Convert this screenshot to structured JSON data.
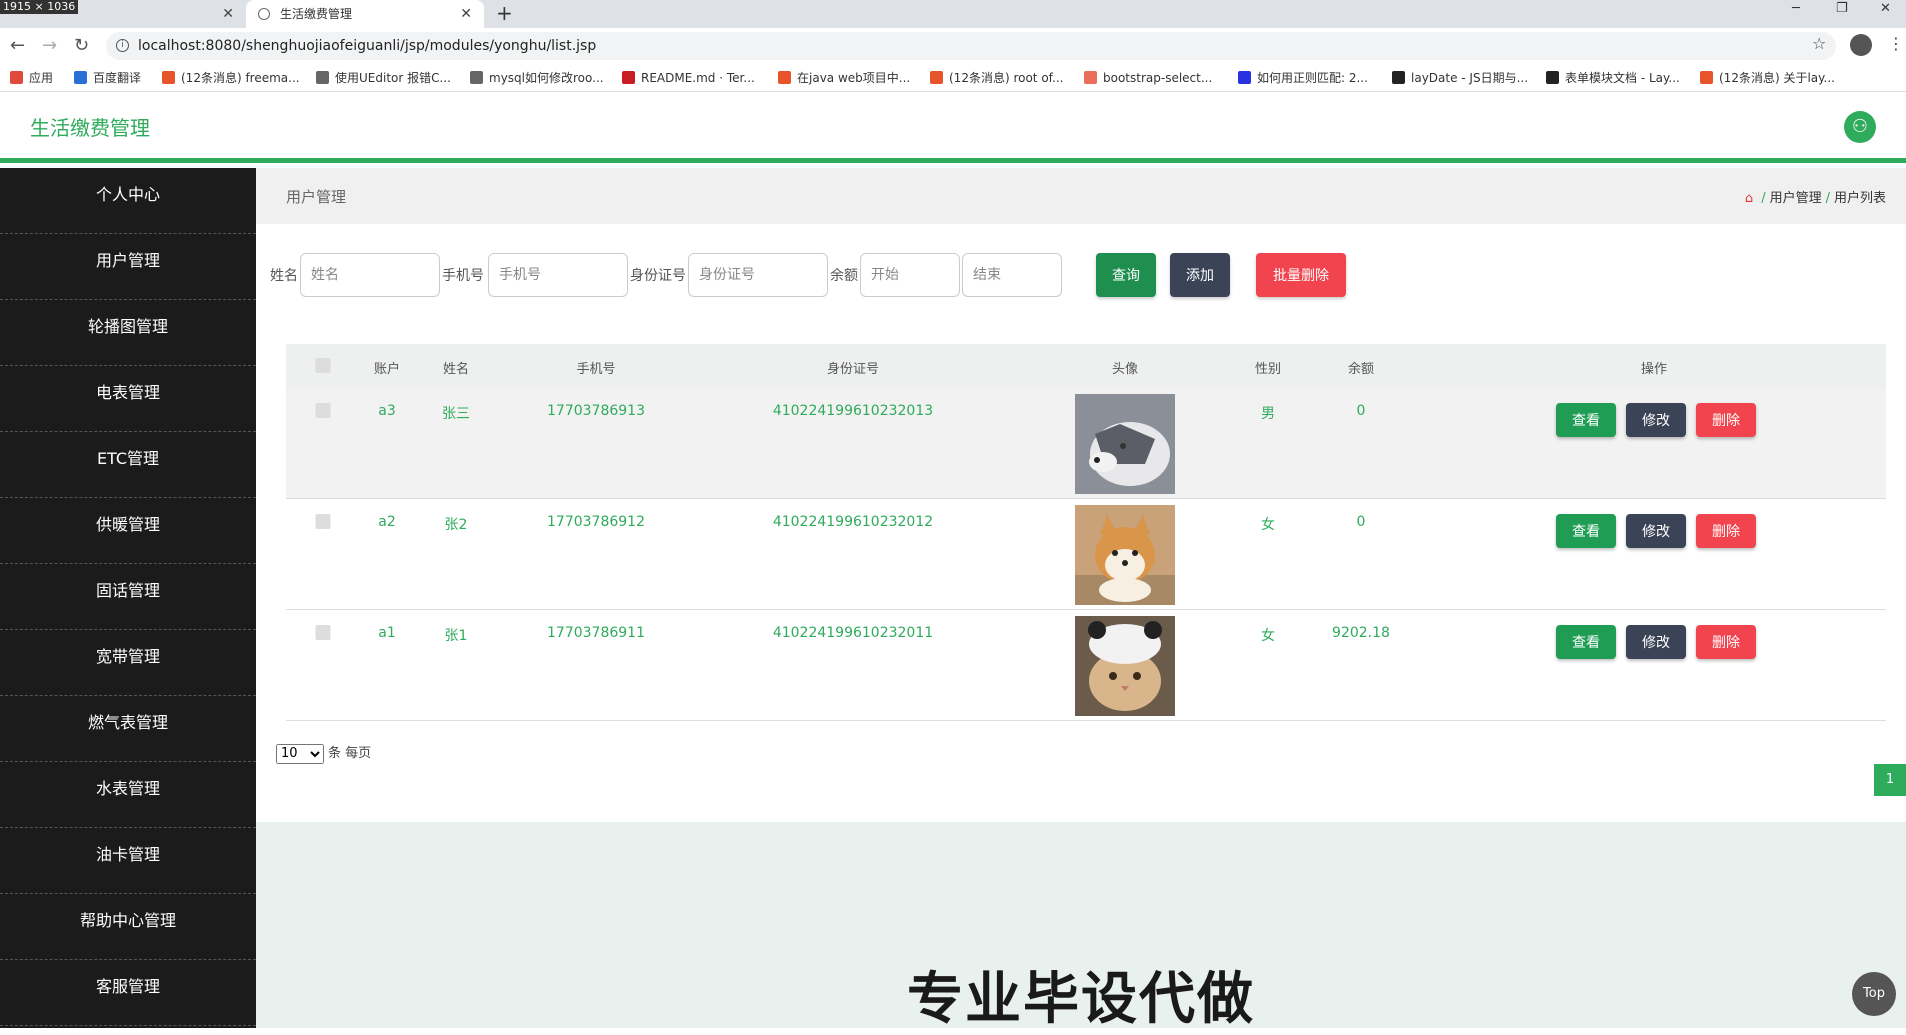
{
  "browser": {
    "dim_label": "1915 × 1036",
    "tabs": [
      {
        "label": "",
        "active": false
      },
      {
        "label": "生活缴费管理",
        "active": true
      }
    ],
    "new_tab": "+",
    "url": "localhost:8080/shenghuojiaofeiguanli/jsp/modules/yonghu/list.jsp",
    "bookmarks": [
      {
        "label": "应用",
        "icon": "apps-grid-icon",
        "color": "#e04a3a"
      },
      {
        "label": "百度翻译",
        "icon": "baidu-translate-icon",
        "color": "#2a6fd6"
      },
      {
        "label": "(12条消息) freema...",
        "icon": "csdn-icon",
        "color": "#e8542a"
      },
      {
        "label": "使用UEditor 报错C...",
        "icon": "ueditor-icon",
        "color": "#666666"
      },
      {
        "label": "mysql如何修改roo...",
        "icon": "mysql-icon",
        "color": "#666666"
      },
      {
        "label": "README.md · Ter...",
        "icon": "gitee-icon",
        "color": "#c71d23"
      },
      {
        "label": "在java web项目中...",
        "icon": "csdn-icon",
        "color": "#e8542a"
      },
      {
        "label": "(12条消息) root of...",
        "icon": "csdn-icon",
        "color": "#e8542a"
      },
      {
        "label": "bootstrap-select...",
        "icon": "jianshu-icon",
        "color": "#ea6f5a"
      },
      {
        "label": "如何用正则匹配: 2...",
        "icon": "baidu-paw-icon",
        "color": "#2932e1"
      },
      {
        "label": "layDate - JS日期与...",
        "icon": "layui-icon",
        "color": "#222222"
      },
      {
        "label": "表单模块文档 - Lay...",
        "icon": "layui-icon",
        "color": "#222222"
      },
      {
        "label": "(12条消息) 关于lay...",
        "icon": "csdn-icon",
        "color": "#e8542a"
      }
    ]
  },
  "app": {
    "brand": "生活缴费管理",
    "accent": "#2eab5b"
  },
  "sidebar": {
    "items": [
      "个人中心",
      "用户管理",
      "轮播图管理",
      "电表管理",
      "ETC管理",
      "供暖管理",
      "固话管理",
      "宽带管理",
      "燃气表管理",
      "水表管理",
      "油卡管理",
      "帮助中心管理",
      "客服管理"
    ]
  },
  "main": {
    "page_title": "用户管理",
    "breadcrumb": [
      "用户管理",
      "用户列表"
    ],
    "breadcrumb_sep": "/"
  },
  "search": {
    "name_label": "姓名",
    "name_placeholder": "姓名",
    "phone_label": "手机号",
    "phone_placeholder": "手机号",
    "id_label": "身份证号",
    "id_placeholder": "身份证号",
    "balance_label": "余额",
    "start_placeholder": "开始",
    "end_placeholder": "结束",
    "query_btn": "查询",
    "add_btn": "添加",
    "batch_delete_btn": "批量删除"
  },
  "table": {
    "headers": {
      "account": "账户",
      "name": "姓名",
      "phone": "手机号",
      "id_card": "身份证号",
      "avatar": "头像",
      "gender": "性别",
      "balance": "余额",
      "actions": "操作"
    },
    "rows": [
      {
        "account": "a3",
        "name": "张三",
        "phone": "17703786913",
        "id_card": "410224199610232013",
        "avatar": "husky-photo",
        "gender": "男",
        "balance": "0"
      },
      {
        "account": "a2",
        "name": "张2",
        "phone": "17703786912",
        "id_card": "410224199610232012",
        "avatar": "shiba-photo",
        "gender": "女",
        "balance": "0"
      },
      {
        "account": "a1",
        "name": "张1",
        "phone": "17703786911",
        "id_card": "410224199610232011",
        "avatar": "cat-photo",
        "gender": "女",
        "balance": "9202.18"
      }
    ],
    "view_btn": "查看",
    "edit_btn": "修改",
    "delete_btn": "删除"
  },
  "pager": {
    "page_size": "10",
    "page_size_suffix": "条 每页",
    "current_page": "1"
  },
  "promo": {
    "text": "专业毕设代做",
    "top_btn": "Top"
  }
}
